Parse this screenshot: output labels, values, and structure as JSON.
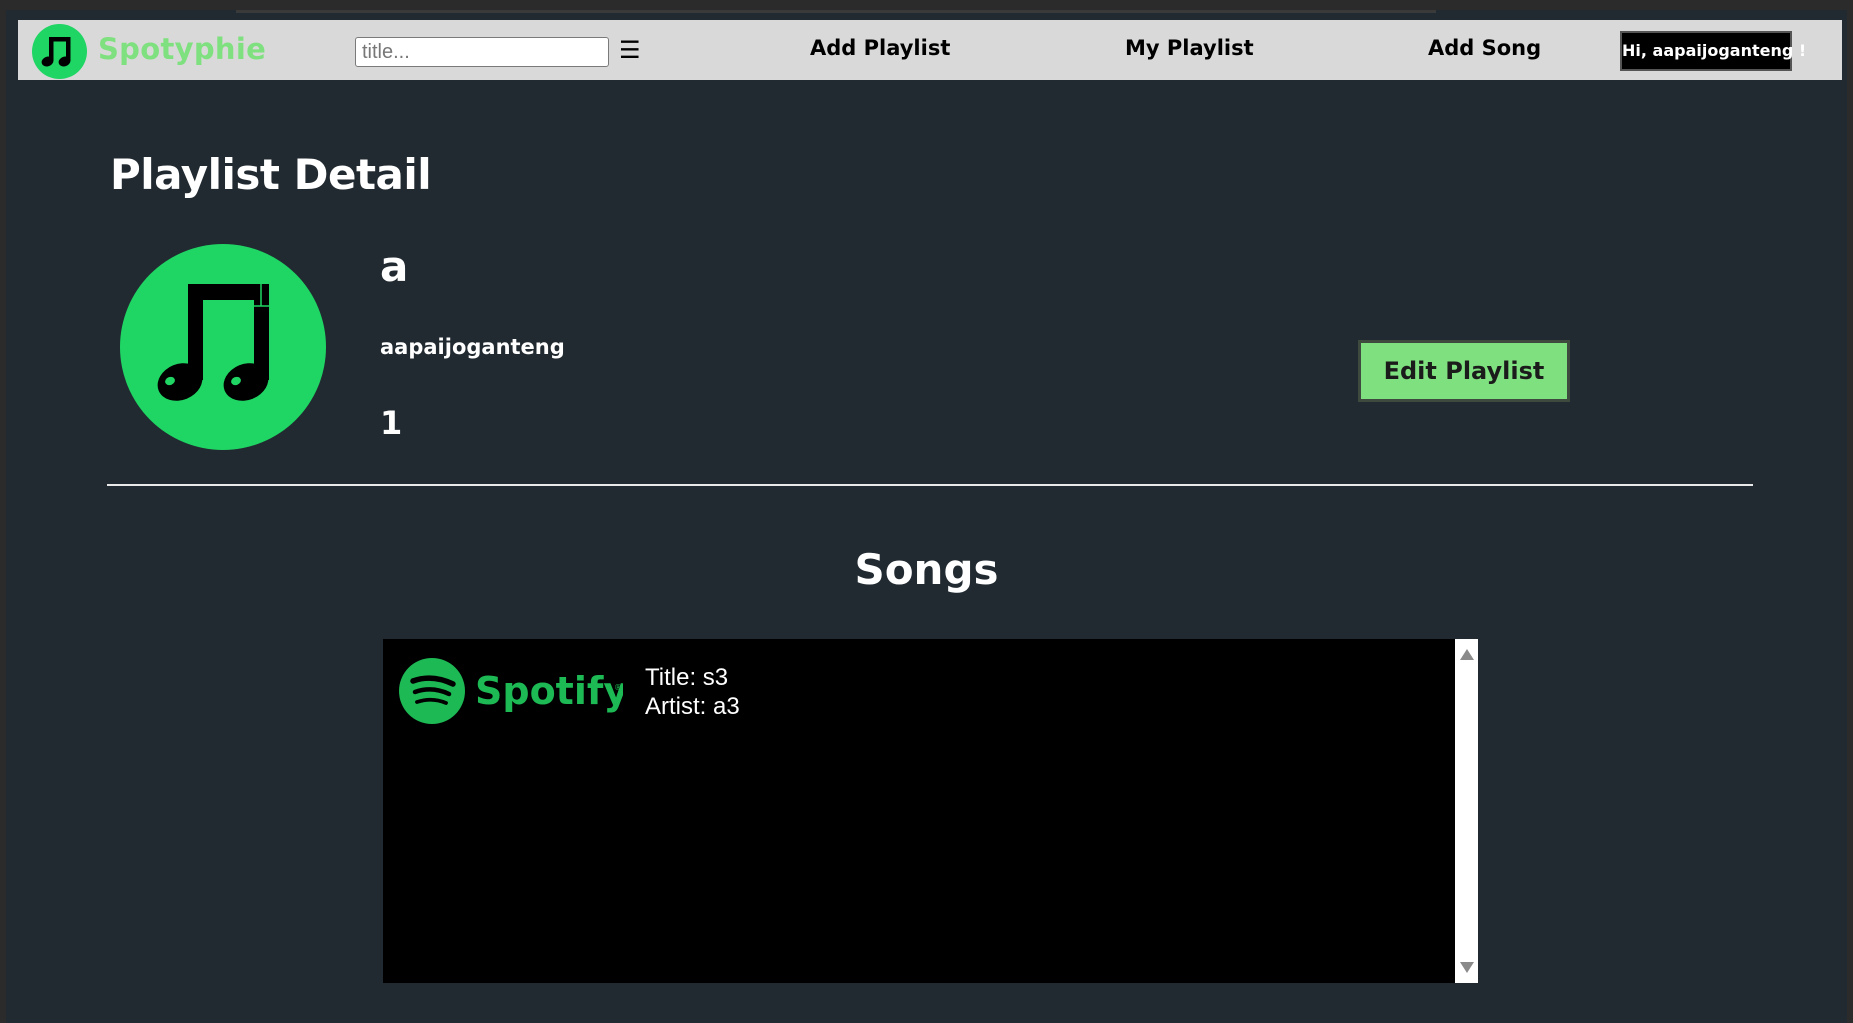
{
  "navbar": {
    "brand": "Spotyphie",
    "search_placeholder": "title...",
    "menu_icon": "☰",
    "links": [
      "Add Playlist",
      "My Playlist",
      "Add Song"
    ],
    "user_greeting": "Hi, aapaijoganteng !"
  },
  "page": {
    "title": "Playlist Detail"
  },
  "playlist": {
    "name": "a",
    "owner": "aapaijoganteng",
    "song_count": "1",
    "edit_label": "Edit Playlist",
    "cover_icon": "music-note-icon"
  },
  "songs": {
    "heading": "Songs",
    "items": [
      {
        "logo_text": "Spotify",
        "logo_mark": "®",
        "title_text": "Title: s3",
        "artist_text": "Artist: a3"
      }
    ]
  },
  "colors": {
    "brand_green": "#1fd563",
    "light_green": "#7ee07e",
    "spotify_green": "#1db954",
    "page_bg": "#212a31",
    "nav_bg": "#d9d9d9"
  }
}
